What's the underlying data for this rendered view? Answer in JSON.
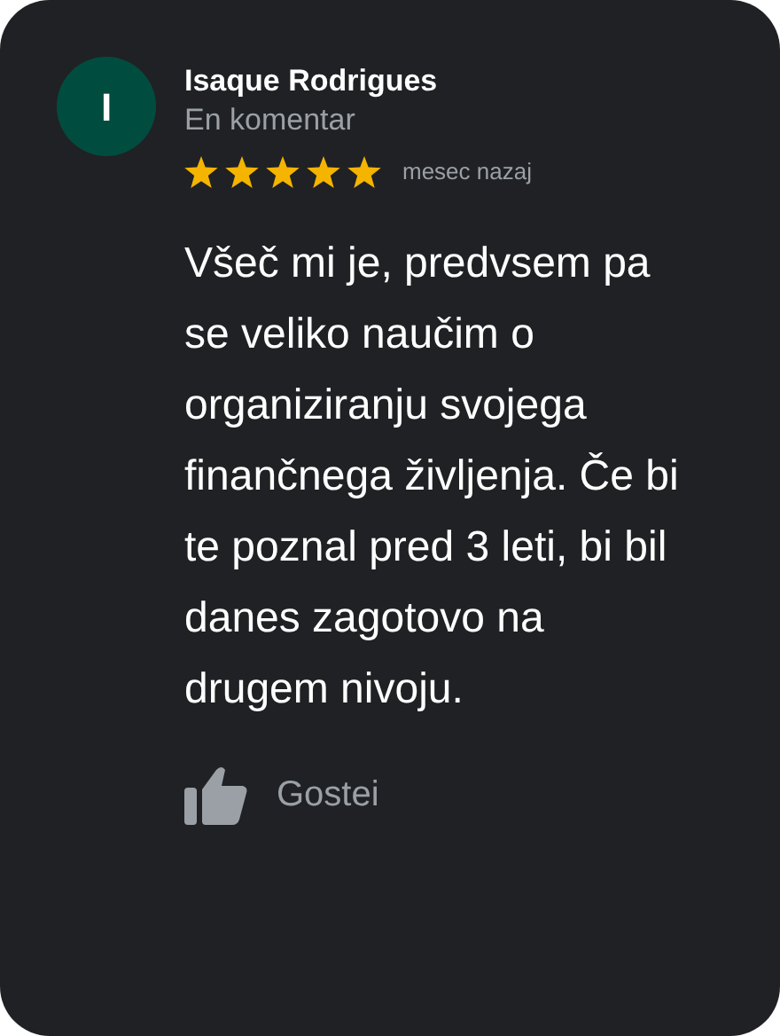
{
  "review": {
    "avatar_letter": "I",
    "author": "Isaque Rodrigues",
    "subtitle": "En komentar",
    "stars": 5,
    "time": "mesec nazaj",
    "text": "Všeč mi je, predvsem pa se veliko naučim o organiziranju svojega finančnega življenja. Če bi te poznal pred 3 leti, bi bil danes zagotovo na drugem nivoju.",
    "like_label": "Gostei"
  }
}
